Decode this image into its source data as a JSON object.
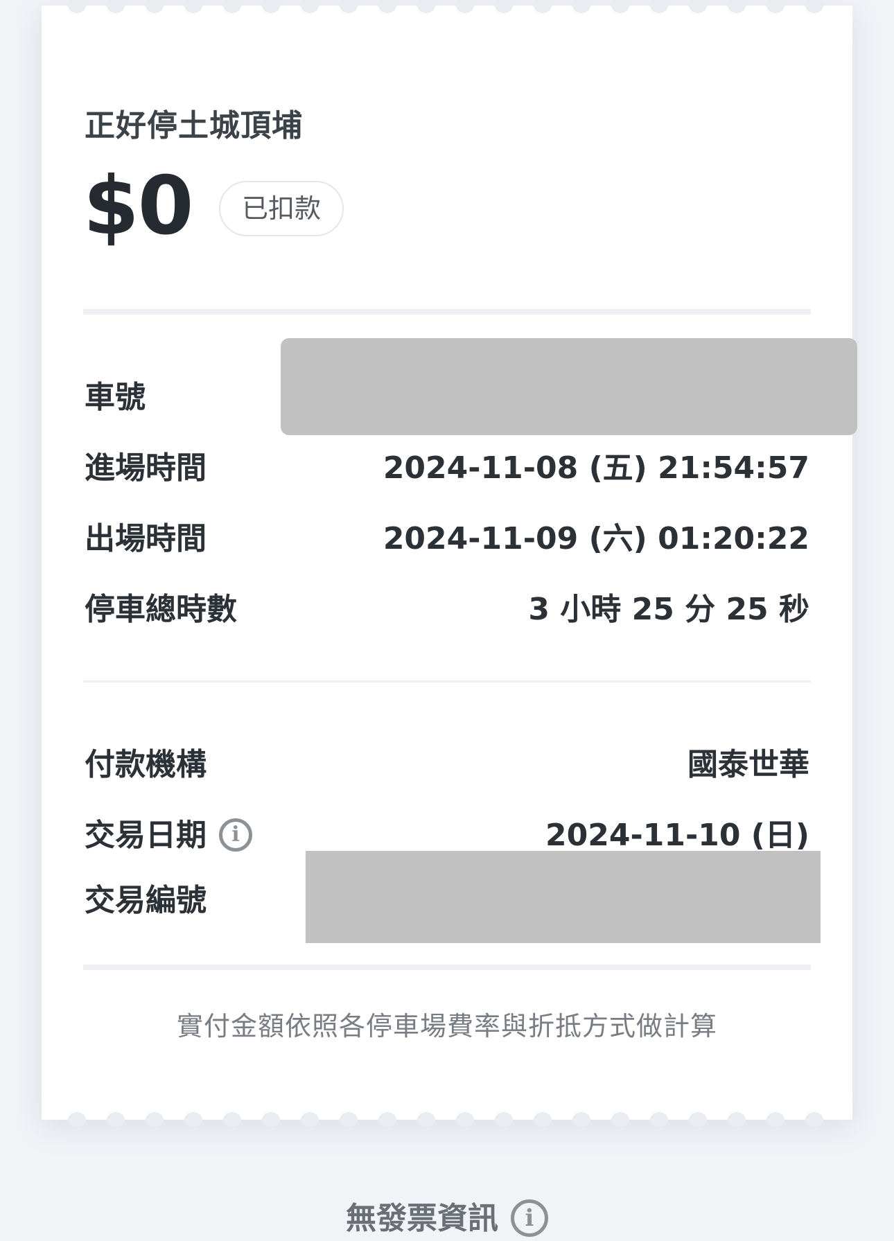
{
  "receipt": {
    "parking_name": "正好停土城頂埔",
    "amount": "$0",
    "status_badge": "已扣款"
  },
  "details": [
    {
      "label": "車號",
      "value": ""
    },
    {
      "label": "進場時間",
      "value": "2024-11-08 (五) 21:54:57"
    },
    {
      "label": "出場時間",
      "value": "2024-11-09 (六) 01:20:22"
    },
    {
      "label": "停車總時數",
      "value": "3 小時 25 分 25 秒"
    }
  ],
  "payment": [
    {
      "label": "付款機構",
      "value": "國泰世華"
    },
    {
      "label": "交易日期",
      "value": "2024-11-10 (日)",
      "info_icon": "info-icon"
    },
    {
      "label": "交易編號",
      "value": ""
    }
  ],
  "footnote": "實付金額依照各停車場費率與折抵方式做計算",
  "invoice": {
    "label": "無發票資訊",
    "icon": "info-icon"
  },
  "colors": {
    "background": "#f1f3f7",
    "card": "#ffffff",
    "text": "#2b3136",
    "muted": "#777d83",
    "redaction": "#c1c1c1"
  }
}
